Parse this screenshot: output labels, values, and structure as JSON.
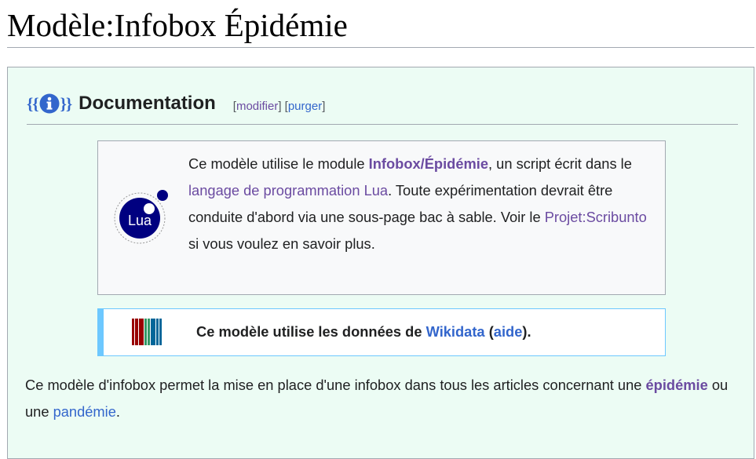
{
  "page": {
    "title": "Modèle:Infobox Épidémie"
  },
  "documentation": {
    "logo_text": "{{i}}",
    "heading": "Documentation",
    "links": {
      "open": "[",
      "modify": "modifier",
      "sep": "] [",
      "purge": "purger",
      "close": "]"
    }
  },
  "lua_notice": {
    "logo_label": "Lua",
    "text_1": "Ce modèle utilise le module ",
    "module_link": "Infobox/Épidémie",
    "text_2": ", un script écrit dans le ",
    "language_link": "langage de programmation Lua",
    "text_3": ". Toute expérimentation devrait être conduite d'abord via une sous-page bac à sable. Voir le ",
    "project_link": "Projet:Scribunto",
    "text_4": " si vous voulez en savoir plus."
  },
  "wikidata_notice": {
    "text_1": "Ce modèle utilise les données de ",
    "wikidata_link": "Wikidata",
    "text_2": " (",
    "help_link": "aide",
    "text_3": ")."
  },
  "description": {
    "text_1": "Ce modèle d'infobox permet la mise en place d'une infobox dans tous les articles concernant une ",
    "epidemic_link": "épidémie",
    "text_2": " ou une ",
    "pandemic_link": "pandémie",
    "text_3": "."
  },
  "colors": {
    "link_blue": "#3366cc",
    "link_visited": "#6b4ba1",
    "doc_background": "#ecfcf4",
    "wikidata_border": "#6dc8ff",
    "lua_blue": "#000080"
  }
}
